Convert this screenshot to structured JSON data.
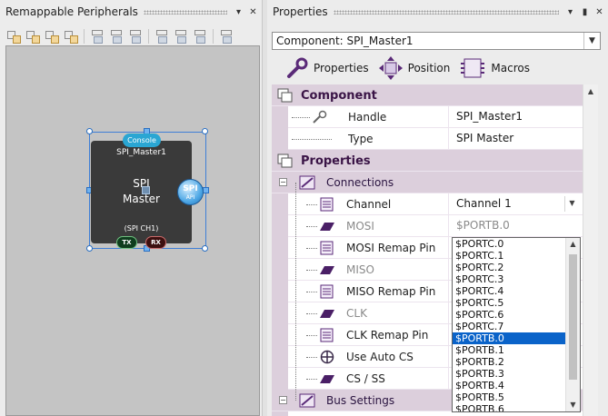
{
  "left_panel": {
    "title": "Remappable Peripherals",
    "pin_icon": "pin-icon",
    "close_icon": "close-icon",
    "toolbar_icons": [
      "align-icon",
      "align-icon",
      "align-icon",
      "align-icon",
      "align-left-icon",
      "align-center-icon",
      "align-right-icon",
      "align-top-icon",
      "align-middle-icon",
      "align-bottom-icon",
      "distribute-icon"
    ],
    "component": {
      "console_tag": "Console",
      "instance_name": "SPI_Master1",
      "title_line1": "SPI",
      "title_line2": "Master",
      "channel_note": "(SPI CH1)",
      "badge_main": "SPI",
      "badge_sub": "API",
      "pins": [
        "TX",
        "RX"
      ]
    }
  },
  "right_panel": {
    "title": "Properties",
    "component_select": "Component: SPI_Master1",
    "tabs": [
      {
        "label": "Properties",
        "icon": "wrench-icon"
      },
      {
        "label": "Position",
        "icon": "move-icon"
      },
      {
        "label": "Macros",
        "icon": "macros-icon"
      }
    ],
    "grid": {
      "cat_component": "Component",
      "handle_label": "Handle",
      "handle_value": "SPI_Master1",
      "type_label": "Type",
      "type_value": "SPI Master",
      "cat_properties": "Properties",
      "connections": "Connections",
      "channel_label": "Channel",
      "channel_value": "Channel 1",
      "mosi_label": "MOSI",
      "mosi_value": "$PORTB.0",
      "mosi_remap_label": "MOSI Remap Pin",
      "miso_label": "MISO",
      "miso_remap_label": "MISO Remap Pin",
      "clk_label": "CLK",
      "clk_remap_label": "CLK Remap Pin",
      "use_auto_cs_label": "Use Auto CS",
      "cs_label": "CS / SS",
      "bus_settings": "Bus Settings"
    },
    "pin_list": {
      "options": [
        "$PORTC.0",
        "$PORTC.1",
        "$PORTC.2",
        "$PORTC.3",
        "$PORTC.4",
        "$PORTC.5",
        "$PORTC.6",
        "$PORTC.7",
        "$PORTB.0",
        "$PORTB.1",
        "$PORTB.2",
        "$PORTB.3",
        "$PORTB.4",
        "$PORTB.5",
        "$PORTB.6"
      ],
      "selected": "$PORTB.0"
    }
  },
  "colors": {
    "category_bg": "#dccfdc",
    "selection": "#0a63c9",
    "component_body": "#3a3a3a",
    "console_tag": "#2aa6d3"
  }
}
